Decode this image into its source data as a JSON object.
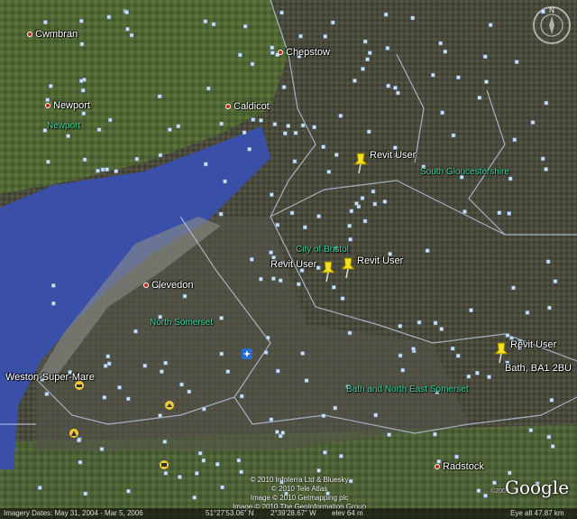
{
  "places": [
    {
      "name": "Cwmbran"
    },
    {
      "name": "Newport"
    },
    {
      "name": "Chepstow"
    },
    {
      "name": "Caldicot"
    },
    {
      "name": "Clevedon"
    },
    {
      "name": "Weston-Super-Mare"
    },
    {
      "name": "Radstock"
    }
  ],
  "regions": [
    {
      "name": "Newport"
    },
    {
      "name": "South Gloucestershire"
    },
    {
      "name": "City of Bristol"
    },
    {
      "name": "North Somerset"
    },
    {
      "name": "Bath and North East Somerset"
    }
  ],
  "pins": [
    {
      "label": "Revit User"
    },
    {
      "label": "Revit User"
    },
    {
      "label": "Revit User"
    },
    {
      "label": "Revit User"
    },
    {
      "label": "Bath, BA1 2BU"
    }
  ],
  "compass": {
    "label": "N"
  },
  "credits": [
    "© 2010 Infoterra Ltd & Bluesky",
    "© 2010 Tele Atlas",
    "Image © 2010 Getmapping plc",
    "Image © 2010 The GeoInformation Group"
  ],
  "status": {
    "imagery_dates": "Imagery Dates: May 31, 2004 - Mar 5, 2006",
    "lat": "51°27'53.06\" N",
    "lon": "2°39'28.67\" W",
    "elev": "elev   64 m",
    "eye_alt": "Eye alt   47.87 km"
  },
  "logo": {
    "text": "Google",
    "year": "©2009"
  },
  "colors": {
    "water": "#3a4fa8",
    "pin": "#f5e020",
    "region_label": "#3fd6a0",
    "place_dot": "#c0281c"
  }
}
